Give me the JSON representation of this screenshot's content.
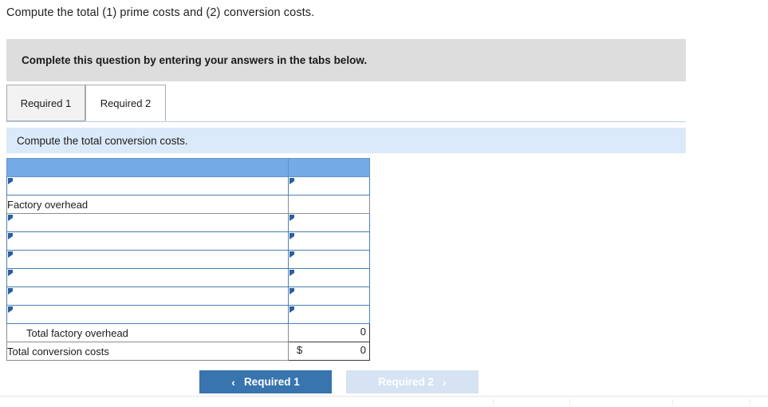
{
  "question": {
    "prompt": "Compute the total (1) prime costs and (2) conversion costs."
  },
  "instruction_banner": {
    "text": "Complete this question by entering your answers in the tabs below."
  },
  "tabs": [
    {
      "label": "Required 1",
      "active": false
    },
    {
      "label": "Required 2",
      "active": true
    }
  ],
  "sub_instruction": {
    "text": "Compute the total conversion costs."
  },
  "worksheet": {
    "header": {
      "label": "",
      "amount": ""
    },
    "rows": [
      {
        "type": "input",
        "label": "",
        "amount": ""
      },
      {
        "type": "static",
        "label": "Factory overhead",
        "amount": ""
      },
      {
        "type": "input",
        "label": "",
        "amount": ""
      },
      {
        "type": "input",
        "label": "",
        "amount": ""
      },
      {
        "type": "input",
        "label": "",
        "amount": ""
      },
      {
        "type": "input",
        "label": "",
        "amount": ""
      },
      {
        "type": "input",
        "label": "",
        "amount": ""
      },
      {
        "type": "input",
        "label": "",
        "amount": ""
      },
      {
        "type": "total",
        "label": "Total factory overhead",
        "indent": true,
        "currency": "",
        "amount": "0"
      },
      {
        "type": "total",
        "label": "Total conversion costs",
        "indent": false,
        "currency": "$",
        "amount": "0"
      }
    ]
  },
  "nav": {
    "prev": {
      "label": "Required 1",
      "chevron": "‹",
      "enabled": true
    },
    "next": {
      "label": "Required 2",
      "chevron": "›",
      "enabled": false
    }
  },
  "colors": {
    "banner_gray": "#dddddd",
    "sub_instruction_blue": "#dbeafa",
    "table_header_blue": "#74aae6",
    "input_border_blue": "#4a7fb5",
    "marker_blue": "#2c5f9e",
    "button_primary": "#3874ae",
    "button_disabled": "#d6e3f2"
  }
}
